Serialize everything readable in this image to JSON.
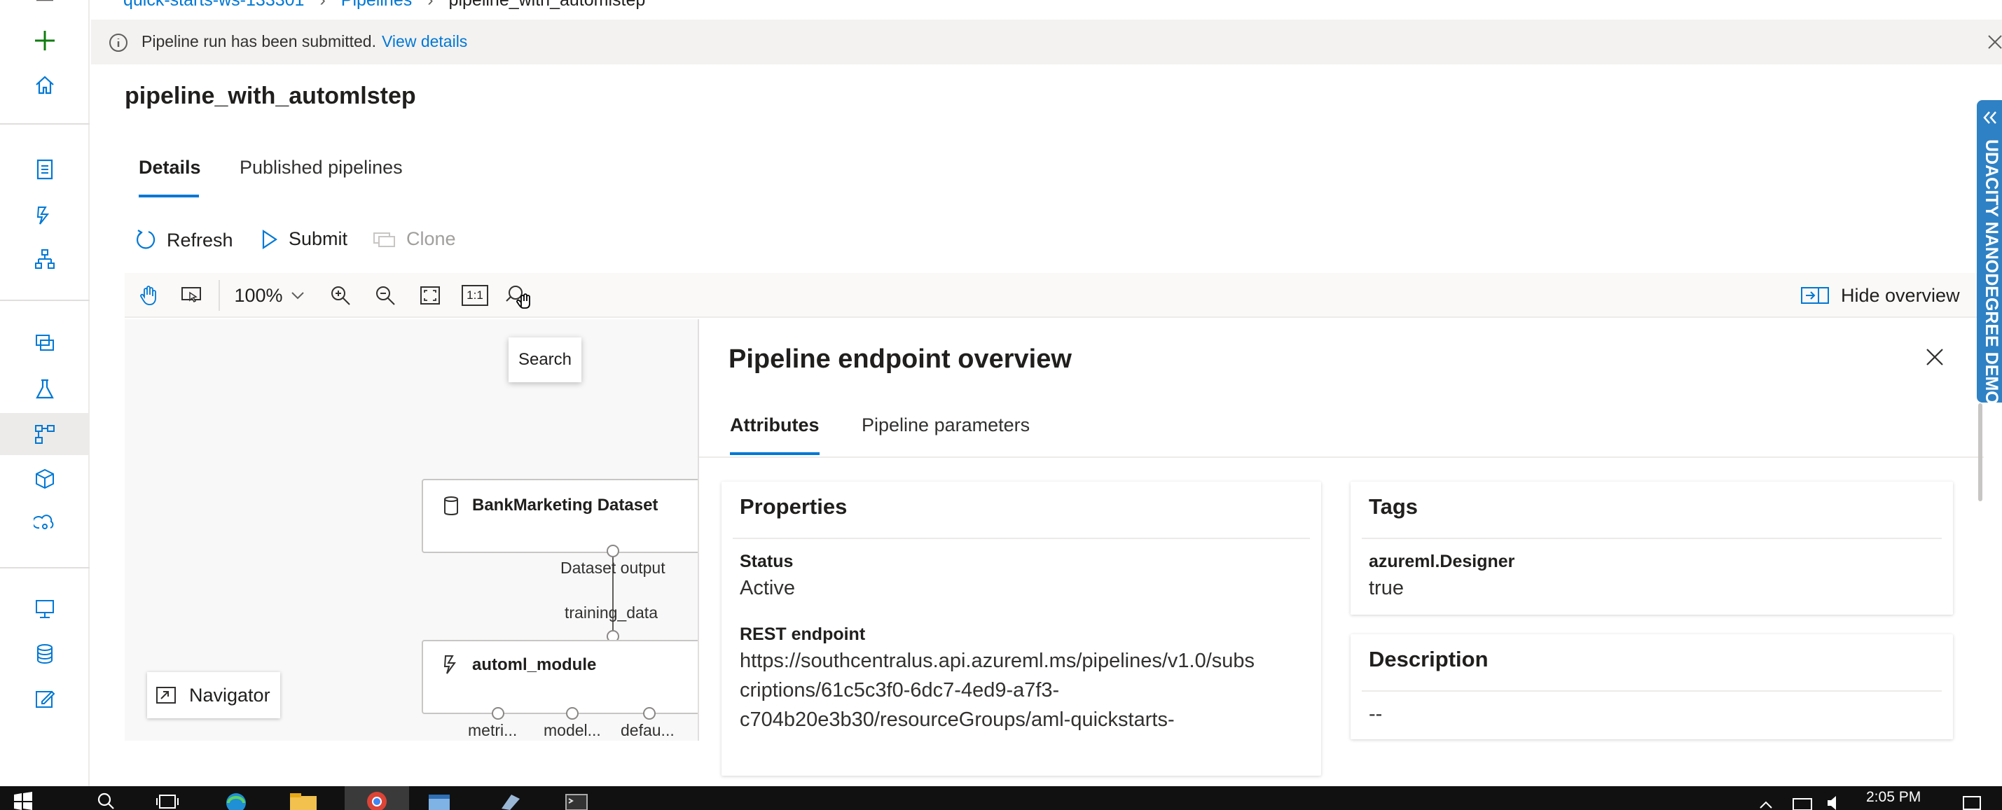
{
  "breadcrumb": {
    "workspace": "quick-starts-ws-133301",
    "section": "Pipelines",
    "current": "pipeline_with_automlstep"
  },
  "notification": {
    "message": "Pipeline run has been submitted.",
    "link": "View details"
  },
  "page": {
    "title": "pipeline_with_automlstep"
  },
  "tabs": [
    "Details",
    "Published pipelines"
  ],
  "commands": {
    "refresh": "Refresh",
    "submit": "Submit",
    "clone": "Clone"
  },
  "canvas_toolbar": {
    "zoom": "100%",
    "one_to_one": "1:1",
    "hide_overview": "Hide overview"
  },
  "tooltip": "Search",
  "graph": {
    "dataset_node": "BankMarketing Dataset",
    "dataset_output": "Dataset output",
    "training_input": "training_data",
    "automl_node": "automl_module",
    "outputs": [
      "metri...",
      "model...",
      "defau..."
    ]
  },
  "navigator": "Navigator",
  "overview": {
    "title": "Pipeline endpoint overview",
    "tabs": [
      "Attributes",
      "Pipeline parameters"
    ],
    "properties": {
      "heading": "Properties",
      "status_label": "Status",
      "status_value": "Active",
      "rest_label": "REST endpoint",
      "rest_line1": "https://southcentralus.api.azureml.ms/pipelines/v1.0/subs",
      "rest_line2": "criptions/61c5c3f0-6dc7-4ed9-a7f3-",
      "rest_line3": "c704b20e3b30/resourceGroups/aml-quickstarts-"
    },
    "tags": {
      "heading": "Tags",
      "key": "azureml.Designer",
      "value": "true"
    },
    "description": {
      "heading": "Description",
      "value": "--"
    }
  },
  "side_banner": "UDACITY NANODEGREE DEMO",
  "taskbar": {
    "time": "2:05 PM"
  },
  "colors": {
    "accent": "#0078d4",
    "banner": "#2e81c4",
    "taskbar": "#111111"
  }
}
